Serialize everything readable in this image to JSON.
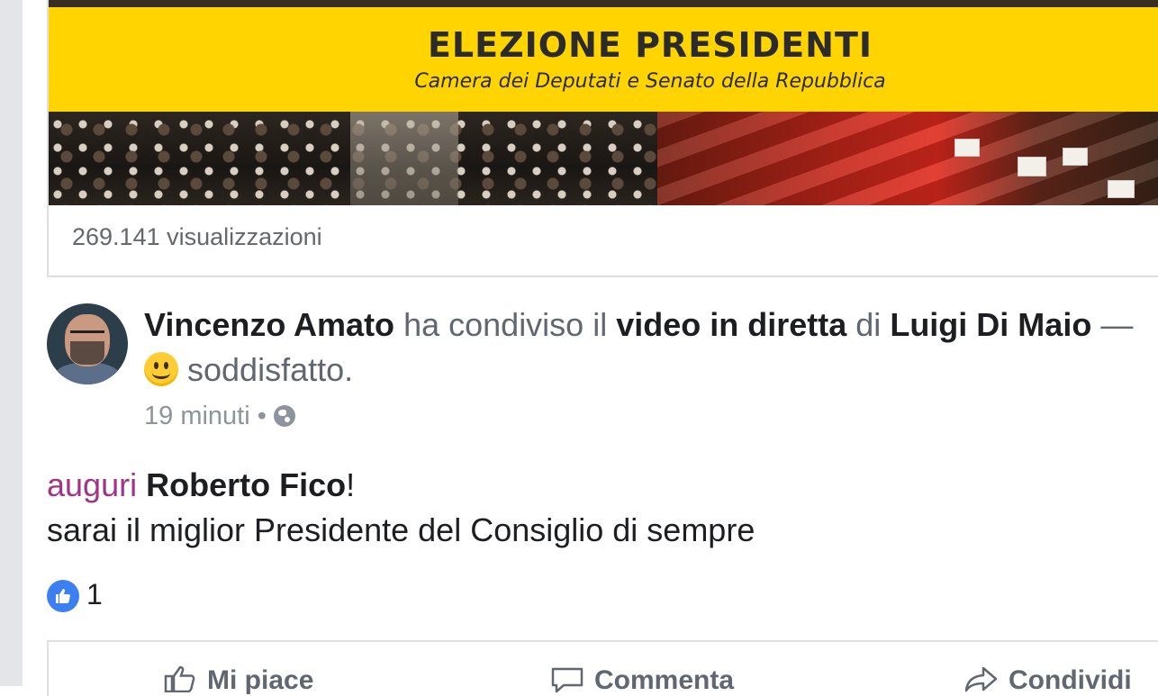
{
  "shared_video": {
    "banner_title": "ELEZIONE PRESIDENTI",
    "banner_subtitle": "Camera dei Deputati e Senato della Repubblica",
    "views": "269.141 visualizzazioni"
  },
  "post": {
    "author": "Vincenzo Amato",
    "shared_text": "ha condiviso il",
    "shared_object": "video in diretta",
    "of_text": "di",
    "page_name": "Luigi Di Maio",
    "feeling_separator": "—",
    "feeling": "soddisfatto.",
    "timestamp": "19 minuti",
    "meta_separator": "•",
    "body": {
      "hashtag": "auguri",
      "mention": "Roberto Fico",
      "exclaim": "!",
      "line2": "sarai il miglior Presidente del Consiglio di sempre"
    },
    "reactions": {
      "like_count": "1"
    }
  },
  "actions": {
    "like": "Mi piace",
    "comment": "Commenta",
    "share": "Condividi"
  },
  "icons": {
    "privacy": "globe-icon",
    "feeling": "smiley-emoji-icon",
    "reaction": "like-reaction-icon"
  },
  "colors": {
    "banner_yellow": "#ffd400",
    "hashtag": "#a03586",
    "like_blue": "#3b7ff0",
    "secondary_text": "#606770"
  }
}
